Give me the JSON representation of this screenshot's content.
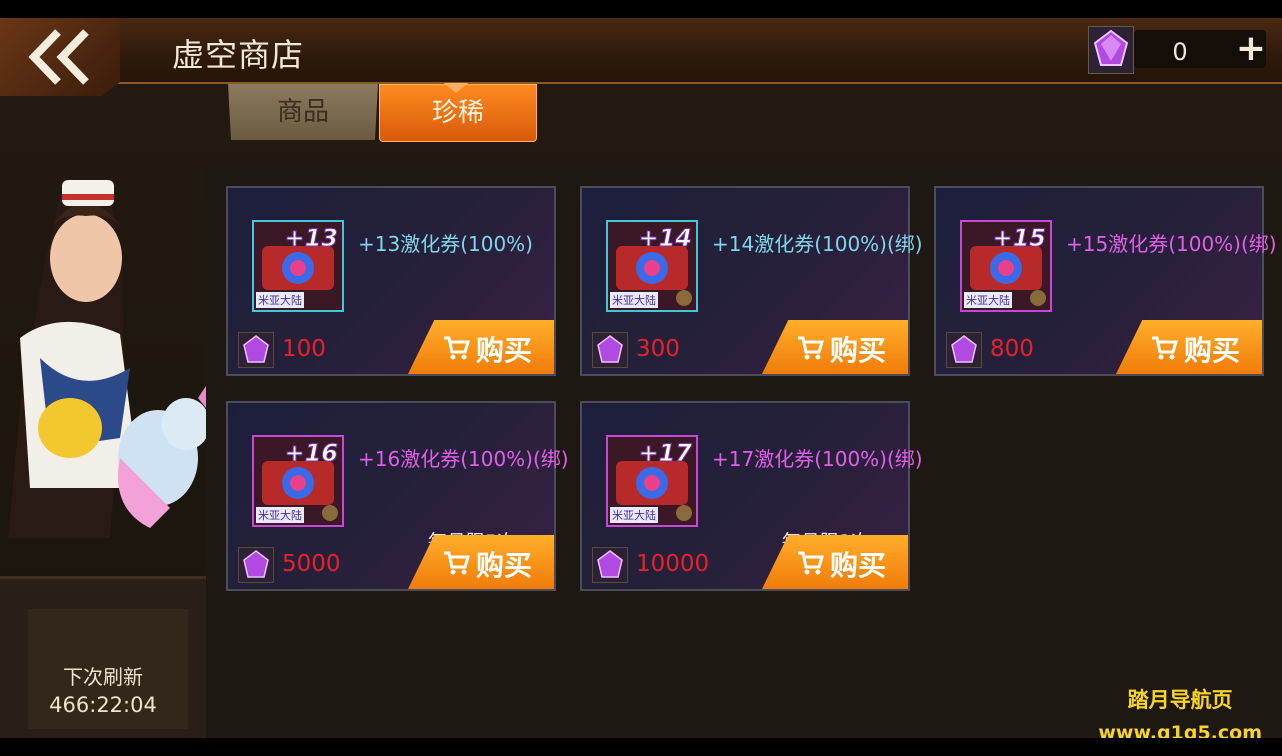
{
  "header": {
    "title": "虚空商店",
    "back_icon": "double-chevron-left-icon",
    "currency": {
      "icon": "purple-gem-icon",
      "amount": "0",
      "add_label": "+"
    }
  },
  "tabs": [
    {
      "label": "商品",
      "active": false
    },
    {
      "label": "珍稀",
      "active": true
    }
  ],
  "items": [
    {
      "level": "+13",
      "name": "+13激化券(100%)",
      "price": "100",
      "limit": "",
      "frame": "cyan",
      "brand": "米亚大陆",
      "buy": "购买"
    },
    {
      "level": "+14",
      "name": "+14激化券(100%)(绑)",
      "price": "300",
      "limit": "",
      "frame": "cyan",
      "brand": "米亚大陆",
      "buy": "购买"
    },
    {
      "level": "+15",
      "name": "+15激化券(100%)(绑)",
      "price": "800",
      "limit": "",
      "frame": "magenta",
      "brand": "米亚大陆",
      "buy": "购买"
    },
    {
      "level": "+16",
      "name": "+16激化券(100%)(绑)",
      "price": "5000",
      "limit": "每月限5次",
      "frame": "magenta",
      "brand": "米亚大陆",
      "buy": "购买"
    },
    {
      "level": "+17",
      "name": "+17激化券(100%)(绑)",
      "price": "10000",
      "limit": "每月限2次",
      "frame": "magenta",
      "brand": "米亚大陆",
      "buy": "购买"
    }
  ],
  "refresh": {
    "label": "下次刷新",
    "time": "466:22:04"
  },
  "watermark": {
    "line1": "踏月导航页",
    "line2": "www.q1q5.com"
  },
  "colors": {
    "accent": "#f07c0a",
    "price": "#e8202a",
    "cyan_item": "#7fd6ea",
    "magenta_item": "#e05ee8"
  }
}
